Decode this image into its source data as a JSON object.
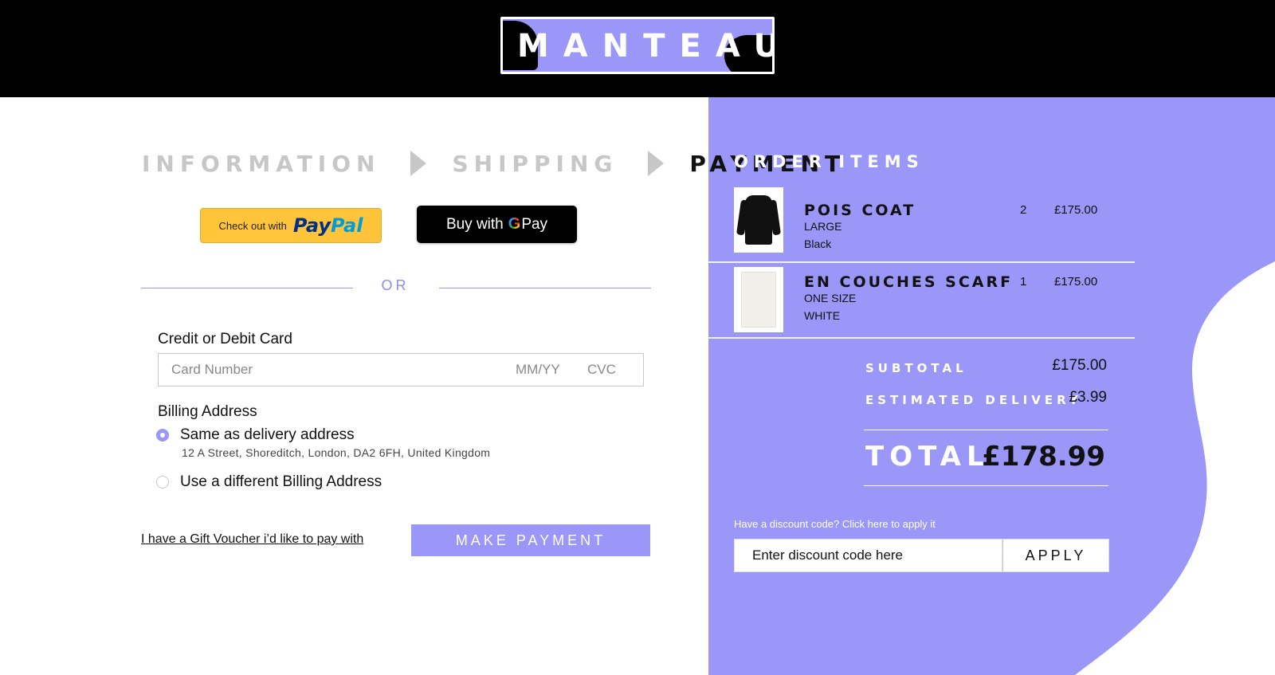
{
  "header": {
    "brand": "MANTEAU"
  },
  "steps": [
    {
      "label": "INFORMATION",
      "state": "done"
    },
    {
      "label": "SHIPPING",
      "state": "done"
    },
    {
      "label": "PAYMENT",
      "state": "active"
    }
  ],
  "express": {
    "paypal_prefix": "Check out with",
    "paypal_word_1": "Pay",
    "paypal_word_2": "Pal",
    "gpay_prefix": "Buy with",
    "gpay_g": "G",
    "gpay_suffix": "Pay"
  },
  "divider_text": "OR",
  "card": {
    "label": "Credit or Debit Card",
    "number_placeholder": "Card Number",
    "expiry_placeholder": "MM/YY",
    "cvc_placeholder": "CVC"
  },
  "billing": {
    "label": "Billing Address",
    "option_same": "Same as delivery address",
    "option_same_checked": true,
    "address": "12 A Street, Shoreditch, London, DA2 6FH, United Kingdom",
    "option_different": "Use a different Billing Address"
  },
  "actions": {
    "gift_voucher": "I have a Gift Voucher i’d like to pay with",
    "make_payment": "MAKE PAYMENT"
  },
  "order": {
    "title": "ORDER ITEMS",
    "items": [
      {
        "name": "POIS COAT",
        "size": "LARGE",
        "color": "Black",
        "qty": "2",
        "price": "£175.00",
        "thumb": "black-coat-image"
      },
      {
        "name": "EN COUCHES SCARF",
        "size": "ONE SIZE",
        "color": "WHITE",
        "qty": "1",
        "price": "£175.00",
        "thumb": "white-scarf-image"
      }
    ],
    "subtotal_label": "SUBTOTAL",
    "subtotal_value": "£175.00",
    "delivery_label": "ESTIMATED DELIVERY",
    "delivery_value": "£3.99",
    "total_label": "TOTAL",
    "total_value": "£178.99"
  },
  "discount": {
    "hint": "Have a discount code? Click here to apply it",
    "placeholder": "Enter discount code here",
    "apply_label": "APPLY"
  },
  "colors": {
    "accent": "#9b97f8",
    "header_bg": "#000000",
    "paypal_yellow": "#ffc439"
  }
}
